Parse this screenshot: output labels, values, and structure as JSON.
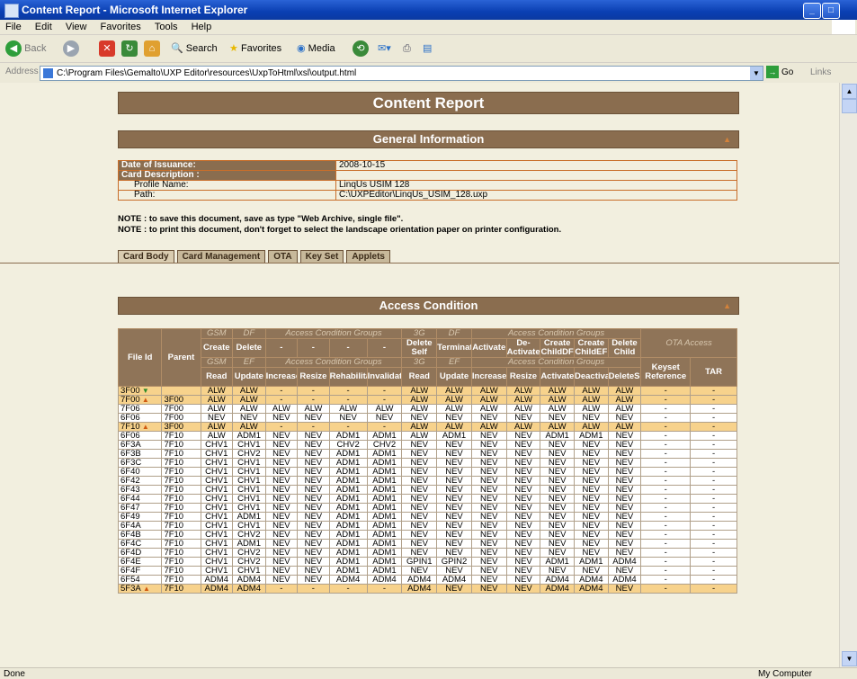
{
  "window": {
    "title": "Content Report - Microsoft Internet Explorer"
  },
  "menu": [
    "File",
    "Edit",
    "View",
    "Favorites",
    "Tools",
    "Help"
  ],
  "toolbar": {
    "back": "Back",
    "search": "Search",
    "favorites": "Favorites",
    "media": "Media"
  },
  "address": {
    "label": "Address",
    "url": "C:\\Program Files\\Gemalto\\UXP Editor\\resources\\UxpToHtml\\xsl\\output.html",
    "go": "Go",
    "links": "Links"
  },
  "status": {
    "left": "Done",
    "right": "My Computer"
  },
  "report": {
    "title": "Content Report",
    "general_title": "General Information",
    "rows": [
      {
        "label": "Date of Issuance:",
        "value": "2008-10-15",
        "sub": false
      },
      {
        "label": "Card Description :",
        "value": "",
        "sub": false
      },
      {
        "label": "Profile Name:",
        "value": "LinqUs USIM 128",
        "sub": true
      },
      {
        "label": "Path:",
        "value": "C:\\UXPEditor\\LinqUs_USIM_128.uxp",
        "sub": true
      }
    ],
    "note1": "NOTE : to save this document, save as type \"Web Archive, single file\".",
    "note2": "NOTE : to print this document, don't forget to select the landscape orientation paper on printer configuration.",
    "tabs": [
      "Card Body",
      "Card Management",
      "OTA",
      "Key Set",
      "Applets"
    ],
    "access_title": "Access Condition"
  },
  "access": {
    "h_file": "File Id",
    "h_parent": "Parent",
    "grp1": [
      "GSM",
      "DF",
      "Access Condition Groups",
      "3G",
      "DF",
      "Access Condition Groups"
    ],
    "grp2": [
      "GSM",
      "EF",
      "Access Condition Groups",
      "3G",
      "EF",
      "Access Condition Groups"
    ],
    "ota": "OTA Access",
    "df_cols": [
      "Create",
      "Delete",
      "-",
      "-",
      "-",
      "-",
      "Delete Self",
      "TerminateDF",
      "Activate",
      "De-Activate",
      "Create ChildDF",
      "Create ChildEF",
      "Delete Child"
    ],
    "ef_cols": [
      "Read",
      "Update",
      "Increase",
      "Resize",
      "Rehabilitate",
      "Invalidate",
      "Read",
      "Update",
      "Increase",
      "Resize",
      "Activate",
      "Deactivate",
      "DeleteSelf"
    ],
    "ota_cols": [
      "Keyset Reference",
      "TAR"
    ],
    "rows": [
      {
        "id": "3F00",
        "mark": "down",
        "parent": "",
        "hl": true,
        "v": [
          "ALW",
          "ALW",
          "-",
          "-",
          "-",
          "-",
          "ALW",
          "ALW",
          "ALW",
          "ALW",
          "ALW",
          "ALW",
          "ALW",
          "-",
          "-"
        ]
      },
      {
        "id": "7F00",
        "mark": "up",
        "parent": "3F00",
        "hl": true,
        "v": [
          "ALW",
          "ALW",
          "-",
          "-",
          "-",
          "-",
          "ALW",
          "ALW",
          "ALW",
          "ALW",
          "ALW",
          "ALW",
          "ALW",
          "-",
          "-"
        ]
      },
      {
        "id": "7F06",
        "mark": "",
        "parent": "7F00",
        "hl": false,
        "v": [
          "ALW",
          "ALW",
          "ALW",
          "ALW",
          "ALW",
          "ALW",
          "ALW",
          "ALW",
          "ALW",
          "ALW",
          "ALW",
          "ALW",
          "ALW",
          "-",
          "-"
        ]
      },
      {
        "id": "6F06",
        "mark": "",
        "parent": "7F00",
        "hl": false,
        "v": [
          "NEV",
          "NEV",
          "NEV",
          "NEV",
          "NEV",
          "NEV",
          "NEV",
          "NEV",
          "NEV",
          "NEV",
          "NEV",
          "NEV",
          "NEV",
          "-",
          "-"
        ]
      },
      {
        "id": "7F10",
        "mark": "up",
        "parent": "3F00",
        "hl": true,
        "v": [
          "ALW",
          "ALW",
          "-",
          "-",
          "-",
          "-",
          "ALW",
          "ALW",
          "ALW",
          "ALW",
          "ALW",
          "ALW",
          "ALW",
          "-",
          "-"
        ]
      },
      {
        "id": "6F06",
        "mark": "",
        "parent": "7F10",
        "hl": false,
        "v": [
          "ALW",
          "ADM1",
          "NEV",
          "NEV",
          "ADM1",
          "ADM1",
          "ALW",
          "ADM1",
          "NEV",
          "NEV",
          "ADM1",
          "ADM1",
          "NEV",
          "-",
          "-"
        ]
      },
      {
        "id": "6F3A",
        "mark": "",
        "parent": "7F10",
        "hl": false,
        "v": [
          "CHV1",
          "CHV1",
          "NEV",
          "NEV",
          "CHV2",
          "CHV2",
          "NEV",
          "NEV",
          "NEV",
          "NEV",
          "NEV",
          "NEV",
          "NEV",
          "-",
          "-"
        ]
      },
      {
        "id": "6F3B",
        "mark": "",
        "parent": "7F10",
        "hl": false,
        "v": [
          "CHV1",
          "CHV2",
          "NEV",
          "NEV",
          "ADM1",
          "ADM1",
          "NEV",
          "NEV",
          "NEV",
          "NEV",
          "NEV",
          "NEV",
          "NEV",
          "-",
          "-"
        ]
      },
      {
        "id": "6F3C",
        "mark": "",
        "parent": "7F10",
        "hl": false,
        "v": [
          "CHV1",
          "CHV1",
          "NEV",
          "NEV",
          "ADM1",
          "ADM1",
          "NEV",
          "NEV",
          "NEV",
          "NEV",
          "NEV",
          "NEV",
          "NEV",
          "-",
          "-"
        ]
      },
      {
        "id": "6F40",
        "mark": "",
        "parent": "7F10",
        "hl": false,
        "v": [
          "CHV1",
          "CHV1",
          "NEV",
          "NEV",
          "ADM1",
          "ADM1",
          "NEV",
          "NEV",
          "NEV",
          "NEV",
          "NEV",
          "NEV",
          "NEV",
          "-",
          "-"
        ]
      },
      {
        "id": "6F42",
        "mark": "",
        "parent": "7F10",
        "hl": false,
        "v": [
          "CHV1",
          "CHV1",
          "NEV",
          "NEV",
          "ADM1",
          "ADM1",
          "NEV",
          "NEV",
          "NEV",
          "NEV",
          "NEV",
          "NEV",
          "NEV",
          "-",
          "-"
        ]
      },
      {
        "id": "6F43",
        "mark": "",
        "parent": "7F10",
        "hl": false,
        "v": [
          "CHV1",
          "CHV1",
          "NEV",
          "NEV",
          "ADM1",
          "ADM1",
          "NEV",
          "NEV",
          "NEV",
          "NEV",
          "NEV",
          "NEV",
          "NEV",
          "-",
          "-"
        ]
      },
      {
        "id": "6F44",
        "mark": "",
        "parent": "7F10",
        "hl": false,
        "v": [
          "CHV1",
          "CHV1",
          "NEV",
          "NEV",
          "ADM1",
          "ADM1",
          "NEV",
          "NEV",
          "NEV",
          "NEV",
          "NEV",
          "NEV",
          "NEV",
          "-",
          "-"
        ]
      },
      {
        "id": "6F47",
        "mark": "",
        "parent": "7F10",
        "hl": false,
        "v": [
          "CHV1",
          "CHV1",
          "NEV",
          "NEV",
          "ADM1",
          "ADM1",
          "NEV",
          "NEV",
          "NEV",
          "NEV",
          "NEV",
          "NEV",
          "NEV",
          "-",
          "-"
        ]
      },
      {
        "id": "6F49",
        "mark": "",
        "parent": "7F10",
        "hl": false,
        "v": [
          "CHV1",
          "ADM1",
          "NEV",
          "NEV",
          "ADM1",
          "ADM1",
          "NEV",
          "NEV",
          "NEV",
          "NEV",
          "NEV",
          "NEV",
          "NEV",
          "-",
          "-"
        ]
      },
      {
        "id": "6F4A",
        "mark": "",
        "parent": "7F10",
        "hl": false,
        "v": [
          "CHV1",
          "CHV1",
          "NEV",
          "NEV",
          "ADM1",
          "ADM1",
          "NEV",
          "NEV",
          "NEV",
          "NEV",
          "NEV",
          "NEV",
          "NEV",
          "-",
          "-"
        ]
      },
      {
        "id": "6F4B",
        "mark": "",
        "parent": "7F10",
        "hl": false,
        "v": [
          "CHV1",
          "CHV2",
          "NEV",
          "NEV",
          "ADM1",
          "ADM1",
          "NEV",
          "NEV",
          "NEV",
          "NEV",
          "NEV",
          "NEV",
          "NEV",
          "-",
          "-"
        ]
      },
      {
        "id": "6F4C",
        "mark": "",
        "parent": "7F10",
        "hl": false,
        "v": [
          "CHV1",
          "ADM1",
          "NEV",
          "NEV",
          "ADM1",
          "ADM1",
          "NEV",
          "NEV",
          "NEV",
          "NEV",
          "NEV",
          "NEV",
          "NEV",
          "-",
          "-"
        ]
      },
      {
        "id": "6F4D",
        "mark": "",
        "parent": "7F10",
        "hl": false,
        "v": [
          "CHV1",
          "CHV2",
          "NEV",
          "NEV",
          "ADM1",
          "ADM1",
          "NEV",
          "NEV",
          "NEV",
          "NEV",
          "NEV",
          "NEV",
          "NEV",
          "-",
          "-"
        ]
      },
      {
        "id": "6F4E",
        "mark": "",
        "parent": "7F10",
        "hl": false,
        "v": [
          "CHV1",
          "CHV2",
          "NEV",
          "NEV",
          "ADM1",
          "ADM1",
          "GPIN1",
          "GPIN2",
          "NEV",
          "NEV",
          "ADM1",
          "ADM1",
          "ADM4",
          "-",
          "-"
        ]
      },
      {
        "id": "6F4F",
        "mark": "",
        "parent": "7F10",
        "hl": false,
        "v": [
          "CHV1",
          "CHV1",
          "NEV",
          "NEV",
          "ADM1",
          "ADM1",
          "NEV",
          "NEV",
          "NEV",
          "NEV",
          "NEV",
          "NEV",
          "NEV",
          "-",
          "-"
        ]
      },
      {
        "id": "6F54",
        "mark": "",
        "parent": "7F10",
        "hl": false,
        "v": [
          "ADM4",
          "ADM4",
          "NEV",
          "NEV",
          "ADM4",
          "ADM4",
          "ADM4",
          "ADM4",
          "NEV",
          "NEV",
          "ADM4",
          "ADM4",
          "ADM4",
          "-",
          "-"
        ]
      },
      {
        "id": "5F3A",
        "mark": "up",
        "parent": "7F10",
        "hl": true,
        "v": [
          "ADM4",
          "ADM4",
          "-",
          "-",
          "-",
          "-",
          "ADM4",
          "NEV",
          "NEV",
          "NEV",
          "ADM4",
          "ADM4",
          "NEV",
          "-",
          "-"
        ]
      }
    ]
  }
}
